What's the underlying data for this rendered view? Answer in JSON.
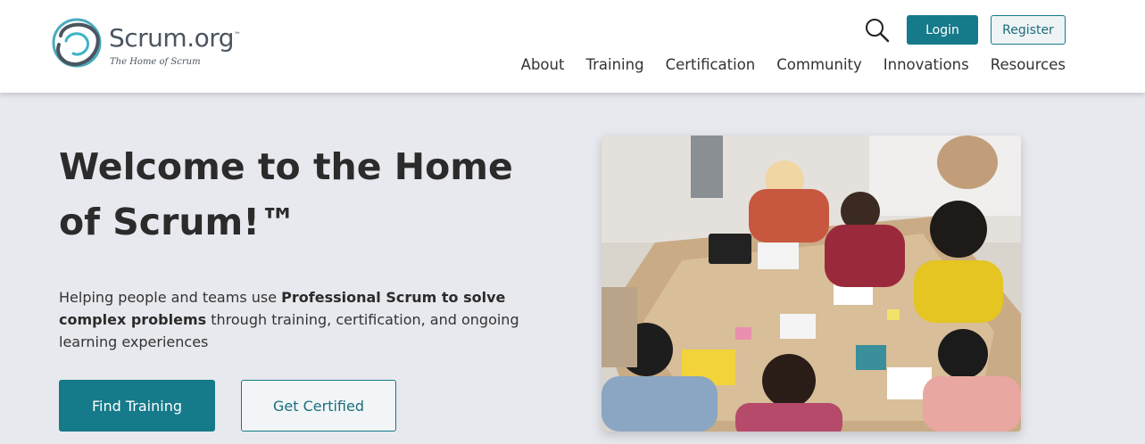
{
  "header": {
    "logo": {
      "wordmark": "Scrum",
      "wordmark_suffix": ".org",
      "trademark": "™",
      "tagline": "The Home of Scrum"
    },
    "search_icon": "search-icon",
    "login_label": "Login",
    "register_label": "Register",
    "nav": [
      "About",
      "Training",
      "Certification",
      "Community",
      "Innovations",
      "Resources"
    ]
  },
  "hero": {
    "title": "Welcome to the Home of Scrum!™",
    "desc_prefix": "Helping people and teams use ",
    "desc_bold": "Professional Scrum to solve complex problems",
    "desc_suffix": " through training, certification, and ongoing learning experiences",
    "primary_button": "Find Training",
    "secondary_button": "Get Certified"
  },
  "colors": {
    "brand": "#157a8a",
    "background": "#e8e9ee",
    "header": "#ffffff",
    "text": "#333333"
  }
}
